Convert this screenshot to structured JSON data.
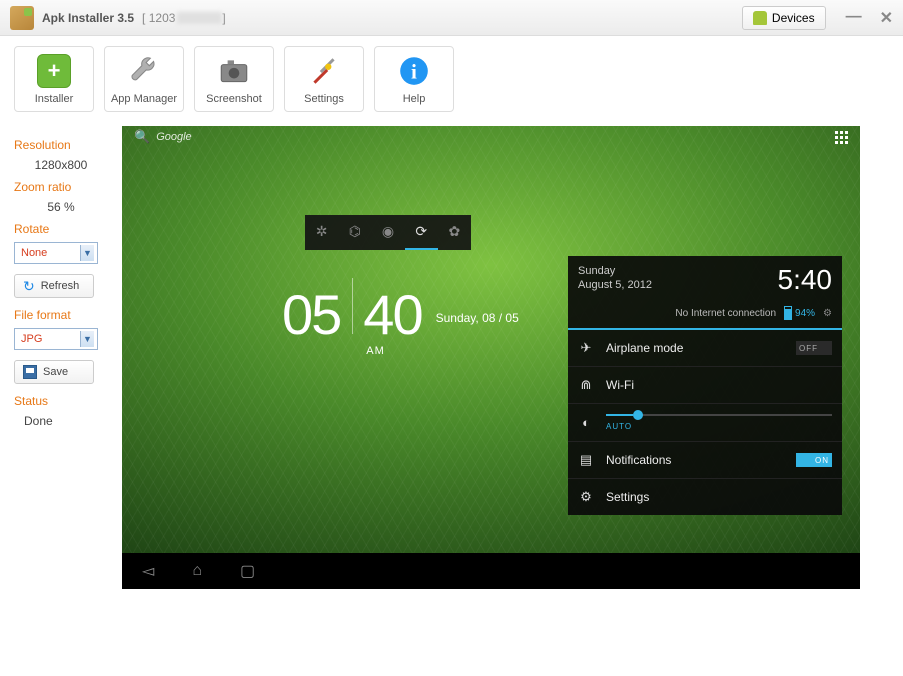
{
  "window": {
    "title": "Apk Installer 3.5",
    "subtitle_prefix": "[ 1203",
    "subtitle_suffix": "]",
    "devices_button": "Devices"
  },
  "toolbar": {
    "installer": "Installer",
    "app_manager": "App Manager",
    "screenshot": "Screenshot",
    "settings": "Settings",
    "help": "Help"
  },
  "sidebar": {
    "resolution_label": "Resolution",
    "resolution_value": "1280x800",
    "zoom_label": "Zoom ratio",
    "zoom_value": "56 %",
    "rotate_label": "Rotate",
    "rotate_value": "None",
    "refresh_button": "Refresh",
    "format_label": "File format",
    "format_value": "JPG",
    "save_button": "Save",
    "status_label": "Status",
    "status_value": "Done"
  },
  "device": {
    "search_text": "Google",
    "clock": {
      "hh": "05",
      "mm": "40",
      "ampm": "AM",
      "date": "Sunday, 08 / 05"
    },
    "brightness_auto": "AUTO",
    "panel": {
      "day": "Sunday",
      "date": "August 5, 2012",
      "time": "5:40",
      "net_status": "No Internet connection",
      "battery": "94%",
      "rows": {
        "airplane": "Airplane mode",
        "airplane_state": "OFF",
        "wifi": "Wi-Fi",
        "notifications": "Notifications",
        "notifications_state": "ON",
        "settings": "Settings"
      }
    }
  }
}
